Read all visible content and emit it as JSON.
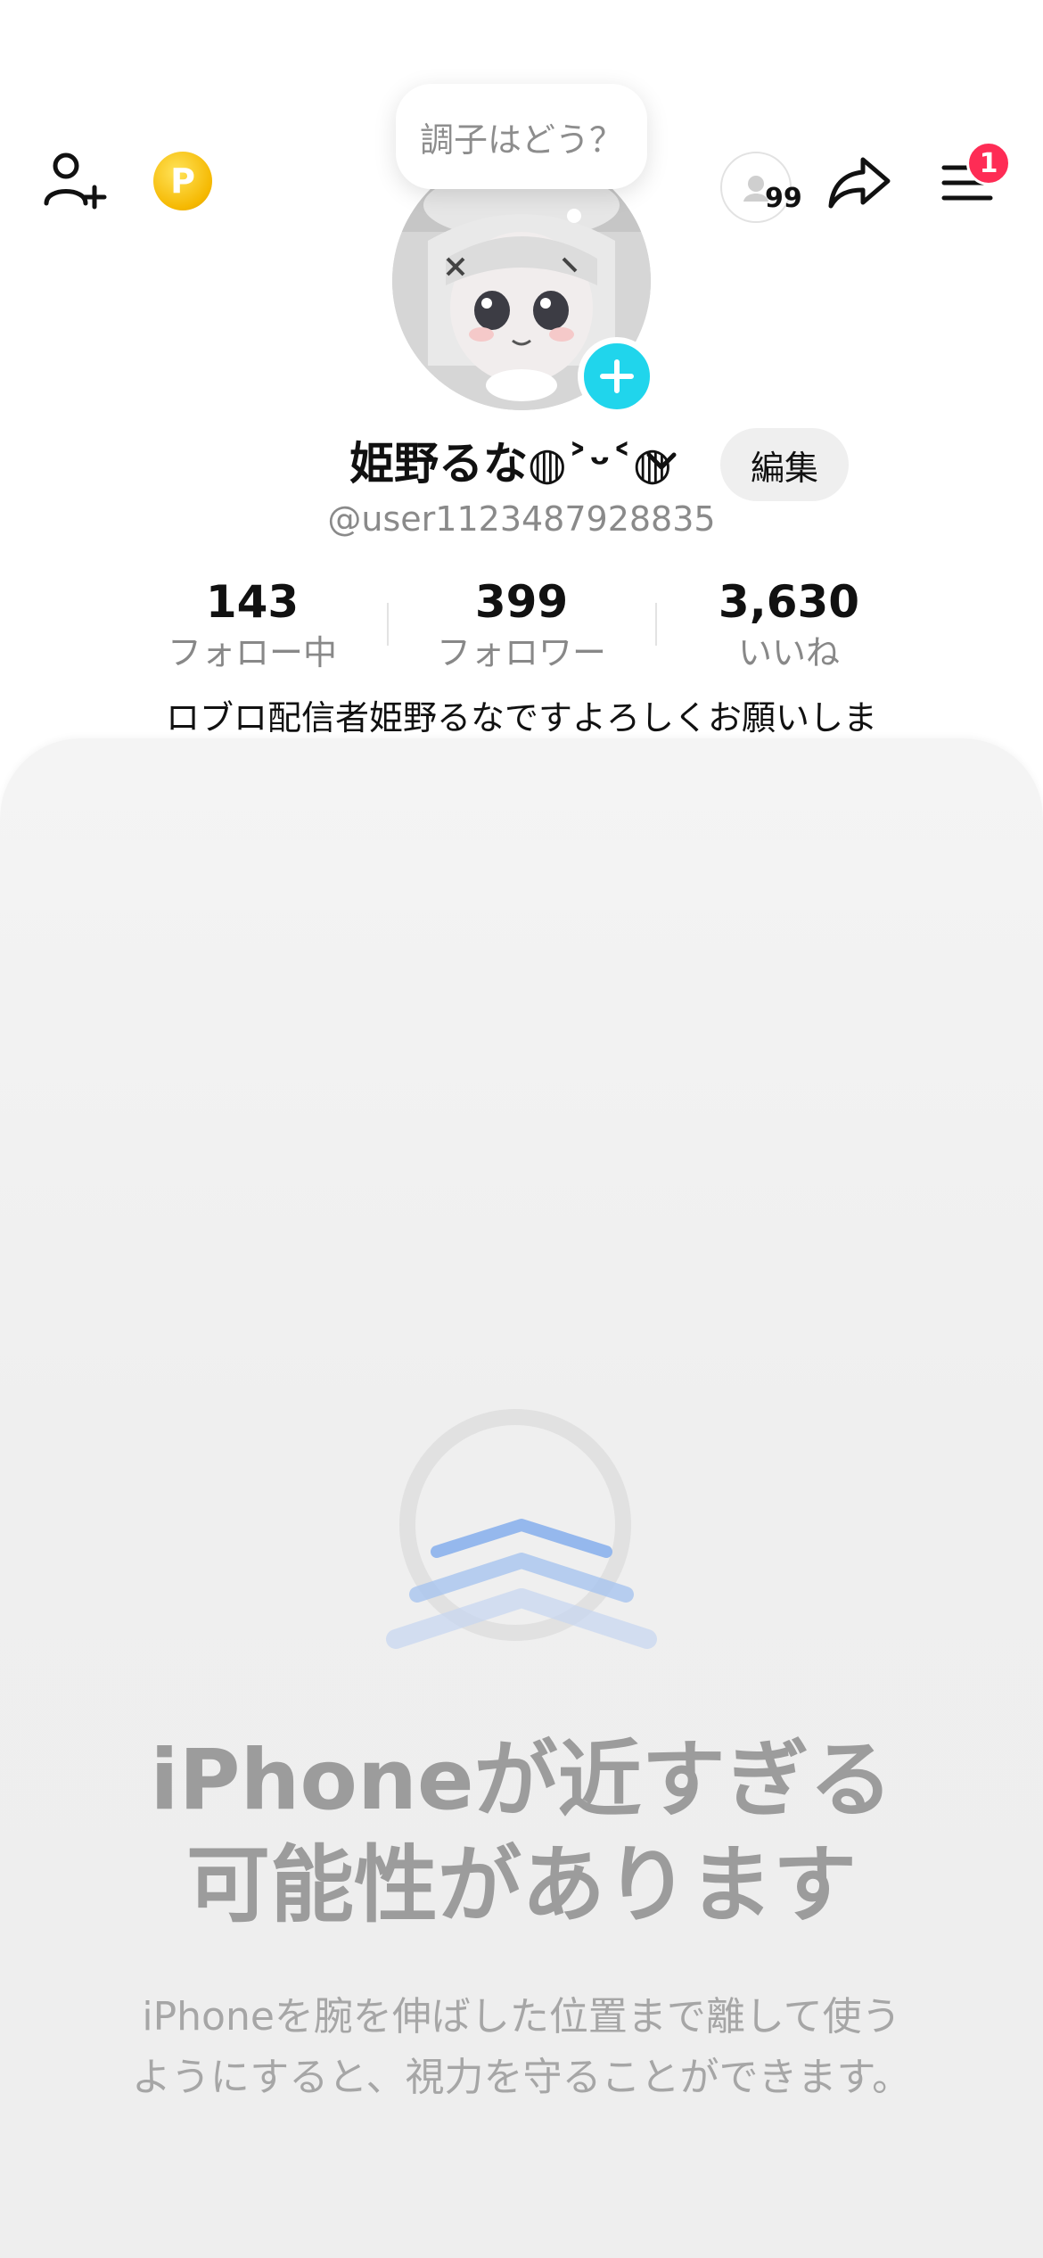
{
  "header": {
    "coin_label": "P",
    "creator_count": "99",
    "notification_count": "1"
  },
  "status_bubble": {
    "text": "調子はどう？"
  },
  "profile": {
    "display_name": "姫野るな◍˃ᵕ˂◍",
    "edit_label": "編集",
    "handle": "@user1123487928835",
    "bio": "ロブロ配信者姫野るなですよろしくお願いしま"
  },
  "stats": [
    {
      "value": "143",
      "label": "フォロー中"
    },
    {
      "value": "399",
      "label": "フォロワー"
    },
    {
      "value": "3,630",
      "label": "いいね"
    }
  ],
  "screen_distance": {
    "title_line1": "iPhoneが近すぎる",
    "title_line2": "可能性があります",
    "body_line1": "iPhoneを腕を伸ばした位置まで離して使う",
    "body_line2": "ようにすると、視力を守ることができます。"
  },
  "colors": {
    "accent_cyan": "#20d5ec",
    "notification_red": "#fe2c55",
    "coin_gold": "#f5b800",
    "chevron_blue": "#8fb4ec"
  },
  "icons": {
    "add_friend": "add-friend-icon",
    "coin": "coin-icon",
    "share": "share-icon",
    "menu": "menu-icon",
    "add_avatar": "plus-icon",
    "dropdown": "chevron-down-icon",
    "distance": "chevrons-up-icon"
  }
}
